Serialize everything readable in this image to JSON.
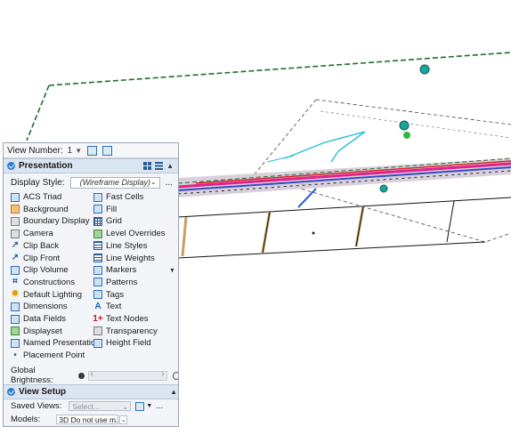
{
  "view_number": {
    "label": "View Number:",
    "value": "1"
  },
  "presentation": {
    "title": "Presentation",
    "display_style_label": "Display Style:",
    "display_style_value": "(Wireframe Display)",
    "more": "...",
    "items_left": [
      {
        "label": "ACS Triad",
        "icon": "acs-triad-icon"
      },
      {
        "label": "Background",
        "icon": "background-icon"
      },
      {
        "label": "Boundary Display",
        "icon": "boundary-display-icon"
      },
      {
        "label": "Camera",
        "icon": "camera-icon"
      },
      {
        "label": "Clip Back",
        "icon": "clip-back-icon"
      },
      {
        "label": "Clip Front",
        "icon": "clip-front-icon"
      },
      {
        "label": "Clip Volume",
        "icon": "clip-volume-icon"
      },
      {
        "label": "Constructions",
        "icon": "constructions-icon"
      },
      {
        "label": "Default Lighting",
        "icon": "default-lighting-icon"
      },
      {
        "label": "Dimensions",
        "icon": "dimensions-icon"
      },
      {
        "label": "Data Fields",
        "icon": "data-fields-icon"
      },
      {
        "label": "Displayset",
        "icon": "displayset-icon"
      },
      {
        "label": "Named Presentation",
        "icon": "named-presentation-icon"
      },
      {
        "label": "Placement Point",
        "icon": "placement-point-icon"
      }
    ],
    "items_right": [
      {
        "label": "Fast Cells",
        "icon": "fast-cells-icon"
      },
      {
        "label": "Fill",
        "icon": "fill-icon"
      },
      {
        "label": "Grid",
        "icon": "grid-icon"
      },
      {
        "label": "Level Overrides",
        "icon": "level-overrides-icon"
      },
      {
        "label": "Line Styles",
        "icon": "line-styles-icon"
      },
      {
        "label": "Line Weights",
        "icon": "line-weights-icon"
      },
      {
        "label": "Markers",
        "icon": "markers-icon"
      },
      {
        "label": "Patterns",
        "icon": "patterns-icon"
      },
      {
        "label": "Tags",
        "icon": "tags-icon"
      },
      {
        "label": "Text",
        "icon": "text-icon"
      },
      {
        "label": "Text Nodes",
        "icon": "text-nodes-icon"
      },
      {
        "label": "Transparency",
        "icon": "transparency-icon"
      },
      {
        "label": "Height Field",
        "icon": "height-field-icon"
      }
    ],
    "global_brightness_label": "Global Brightness:"
  },
  "view_setup": {
    "title": "View Setup",
    "saved_views_label": "Saved Views:",
    "saved_views_value": "Select...",
    "more": "...",
    "models_label": "Models:",
    "models_value": "3D Do not use m..."
  },
  "colors": {
    "accent": "#2e7bd1",
    "section_header": "#dbe5f1",
    "panel_bg": "#f2f4f7"
  }
}
